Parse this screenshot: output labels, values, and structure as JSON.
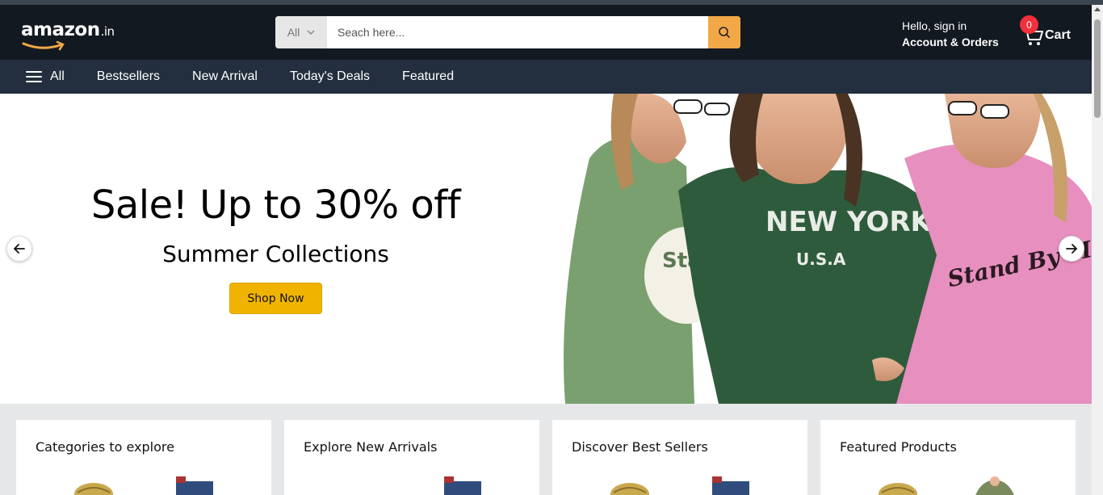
{
  "header": {
    "logo_main": "amazon",
    "logo_tld": ".in",
    "search": {
      "category": "All",
      "placeholder": "Seach here...",
      "button_icon": "search-icon"
    },
    "account": {
      "greeting": "Hello, sign in",
      "label": "Account & Orders"
    },
    "cart": {
      "count": "0",
      "label": "Cart",
      "icon": "cart-icon"
    }
  },
  "nav": {
    "all_label": "All",
    "items": [
      "Bestsellers",
      "New Arrival",
      "Today's Deals",
      "Featured"
    ]
  },
  "hero": {
    "title": "Sale! Up to 30% off",
    "subtitle": "Summer Collections",
    "cta_label": "Shop Now",
    "prev_icon": "arrow-left-icon",
    "next_icon": "arrow-right-icon",
    "image_desc_icon": "hero-fashion-image",
    "shirt_texts": [
      "NEW YORK",
      "U.S.A",
      "Stand By Me",
      "Stay Groovy"
    ]
  },
  "cards": [
    {
      "title": "Categories to explore"
    },
    {
      "title": "Explore New Arrivals"
    },
    {
      "title": "Discover Best Sellers"
    },
    {
      "title": "Featured Products"
    }
  ],
  "colors": {
    "header_bg": "#131921",
    "nav_bg": "#232f3e",
    "search_button": "#f3a847",
    "cta": "#f0b400",
    "badge": "#f0303a"
  }
}
